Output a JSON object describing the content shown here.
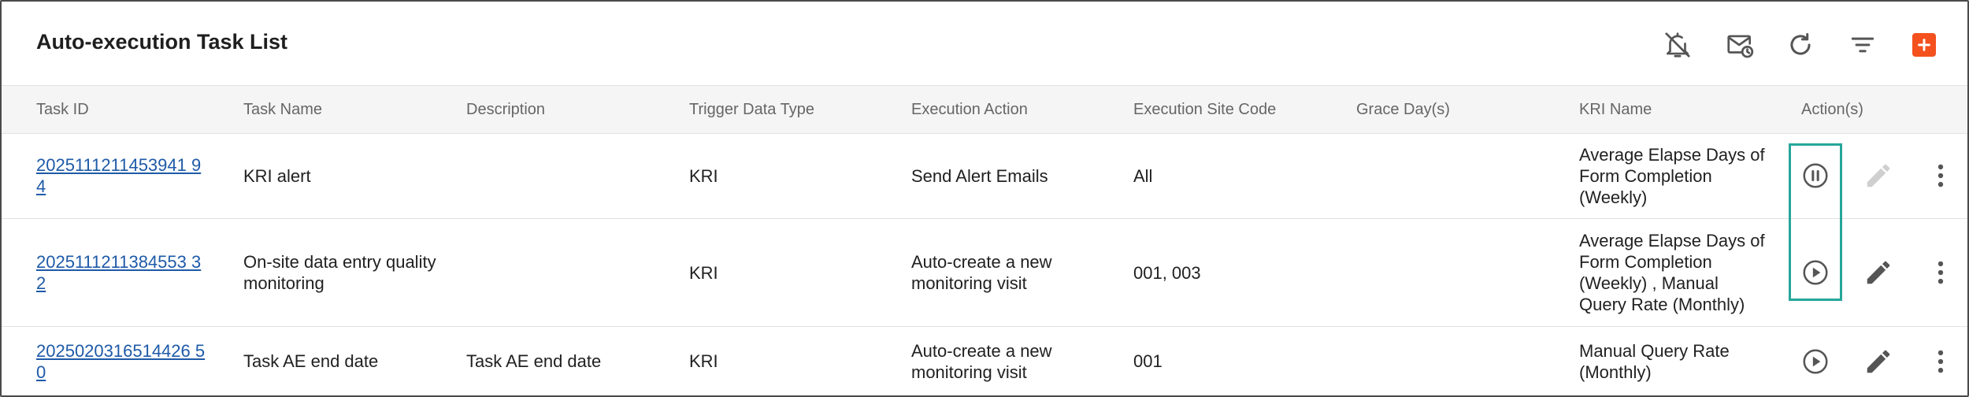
{
  "page": {
    "title": "Auto-execution Task List"
  },
  "toolbar": {
    "icons": [
      "notifications-off-icon",
      "schedule-email-icon",
      "refresh-icon",
      "filter-icon",
      "add-icon"
    ],
    "accent_color": "#f4511e"
  },
  "table": {
    "columns": [
      "Task ID",
      "Task Name",
      "Description",
      "Trigger Data Type",
      "Execution Action",
      "Execution Site Code",
      "Grace Day(s)",
      "KRI Name",
      "Action(s)"
    ],
    "rows": [
      {
        "task_id": "2025111211453941 94",
        "task_name": "KRI alert",
        "description": "",
        "trigger_data_type": "KRI",
        "execution_action": "Send Alert Emails",
        "execution_site_code": "All",
        "grace_days": "",
        "kri_name": "Average Elapse Days of Form Completion (Weekly)",
        "run_state_icon": "pause-circle-icon",
        "edit_enabled": false
      },
      {
        "task_id": "2025111211384553 32",
        "task_name": "On-site data entry quality monitoring",
        "description": "",
        "trigger_data_type": "KRI",
        "execution_action": "Auto-create a new monitoring visit",
        "execution_site_code": "001, 003",
        "grace_days": "",
        "kri_name": "Average Elapse Days of Form Completion (Weekly) , Manual Query Rate (Monthly)",
        "run_state_icon": "play-circle-icon",
        "edit_enabled": true
      },
      {
        "task_id": "2025020316514426 50",
        "task_name": "Task AE end date",
        "description": "Task AE end date",
        "trigger_data_type": "KRI",
        "execution_action": "Auto-create a new monitoring visit",
        "execution_site_code": "001",
        "grace_days": "",
        "kri_name": "Manual Query Rate (Monthly)",
        "run_state_icon": "play-circle-icon",
        "edit_enabled": true
      }
    ]
  },
  "colors": {
    "link": "#1e5aa8",
    "highlight": "#26a69a",
    "header_bg": "#f5f5f5"
  }
}
